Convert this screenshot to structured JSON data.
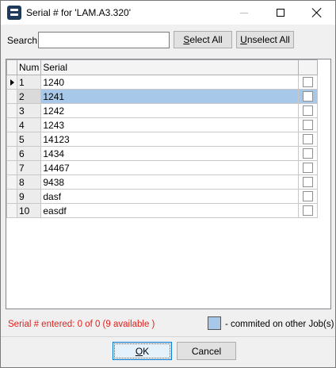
{
  "window": {
    "title": "Serial # for 'LAM.A3.320'",
    "icon": "app-logo-icon"
  },
  "search": {
    "label": "Search",
    "value": "",
    "placeholder": ""
  },
  "buttons": {
    "select_all": "Select All",
    "unselect_all": "Unselect All",
    "ok": "OK",
    "cancel": "Cancel"
  },
  "grid": {
    "columns": [
      "Num",
      "Serial",
      ""
    ],
    "rows": [
      {
        "num": "1",
        "serial": "1240",
        "checked": false
      },
      {
        "num": "2",
        "serial": "1241",
        "checked": false
      },
      {
        "num": "3",
        "serial": "1242",
        "checked": false
      },
      {
        "num": "4",
        "serial": "1243",
        "checked": false
      },
      {
        "num": "5",
        "serial": "14123",
        "checked": false
      },
      {
        "num": "6",
        "serial": "1434",
        "checked": false
      },
      {
        "num": "7",
        "serial": "14467",
        "checked": false
      },
      {
        "num": "8",
        "serial": "9438",
        "checked": false
      },
      {
        "num": "9",
        "serial": "dasf",
        "checked": false
      },
      {
        "num": "10",
        "serial": "easdf",
        "checked": false
      }
    ],
    "current_row": 0,
    "highlighted_row": 1
  },
  "status": {
    "text": "Serial # entered: 0 of 0 (9 available )",
    "color": "#e0201e"
  },
  "legend": {
    "text": "- commited on other Job(s)",
    "color": "#a8c8ea"
  }
}
